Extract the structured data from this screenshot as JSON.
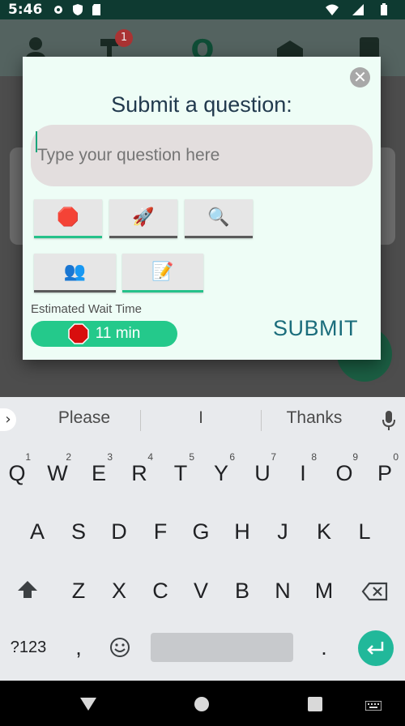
{
  "status_bar": {
    "time": "5:46",
    "left_icons": [
      "gear-icon",
      "shield-icon",
      "sd-card-icon"
    ],
    "right_icons": [
      "wifi-icon",
      "signal-icon",
      "battery-icon"
    ]
  },
  "app_bar": {
    "tabs": [
      "person-icon",
      "hammer-icon",
      "q-logo-icon",
      "inbox-icon",
      "clipboard-icon"
    ],
    "logo_letter": "Q",
    "badge_count": "1"
  },
  "dialog": {
    "title": "Submit a question:",
    "question_placeholder": "Type your question here",
    "question_value": "",
    "tag_buttons": [
      {
        "icon": "stop-sign-icon",
        "glyph": "🛑",
        "selected": true
      },
      {
        "icon": "rocket-icon",
        "glyph": "🚀",
        "selected": false
      },
      {
        "icon": "magnifier-icon",
        "glyph": "🔍",
        "selected": false
      },
      {
        "icon": "people-icon",
        "glyph": "👥",
        "selected": false
      },
      {
        "icon": "memo-icon",
        "glyph": "📝",
        "selected": true
      }
    ],
    "wait_label": "Estimated Wait Time",
    "wait_value": "11 min",
    "submit_label": "SUBMIT",
    "close_glyph": "✕"
  },
  "keyboard": {
    "suggestions": [
      "Please",
      "I",
      "Thanks"
    ],
    "row1": [
      "Q",
      "W",
      "E",
      "R",
      "T",
      "Y",
      "U",
      "I",
      "O",
      "P"
    ],
    "row1_hints": [
      "1",
      "2",
      "3",
      "4",
      "5",
      "6",
      "7",
      "8",
      "9",
      "0"
    ],
    "row2": [
      "A",
      "S",
      "D",
      "F",
      "G",
      "H",
      "J",
      "K",
      "L"
    ],
    "row3": [
      "Z",
      "X",
      "C",
      "V",
      "B",
      "N",
      "M"
    ],
    "symbols_key": "?123",
    "comma_key": ",",
    "period_key": ".",
    "icons": [
      "chevron-right-icon",
      "mic-icon",
      "shift-icon",
      "backspace-icon",
      "emoji-icon",
      "enter-icon"
    ]
  },
  "colors": {
    "accent_green": "#24c98b",
    "title_navy": "#223a4e",
    "submit_teal": "#1b6d7c"
  }
}
